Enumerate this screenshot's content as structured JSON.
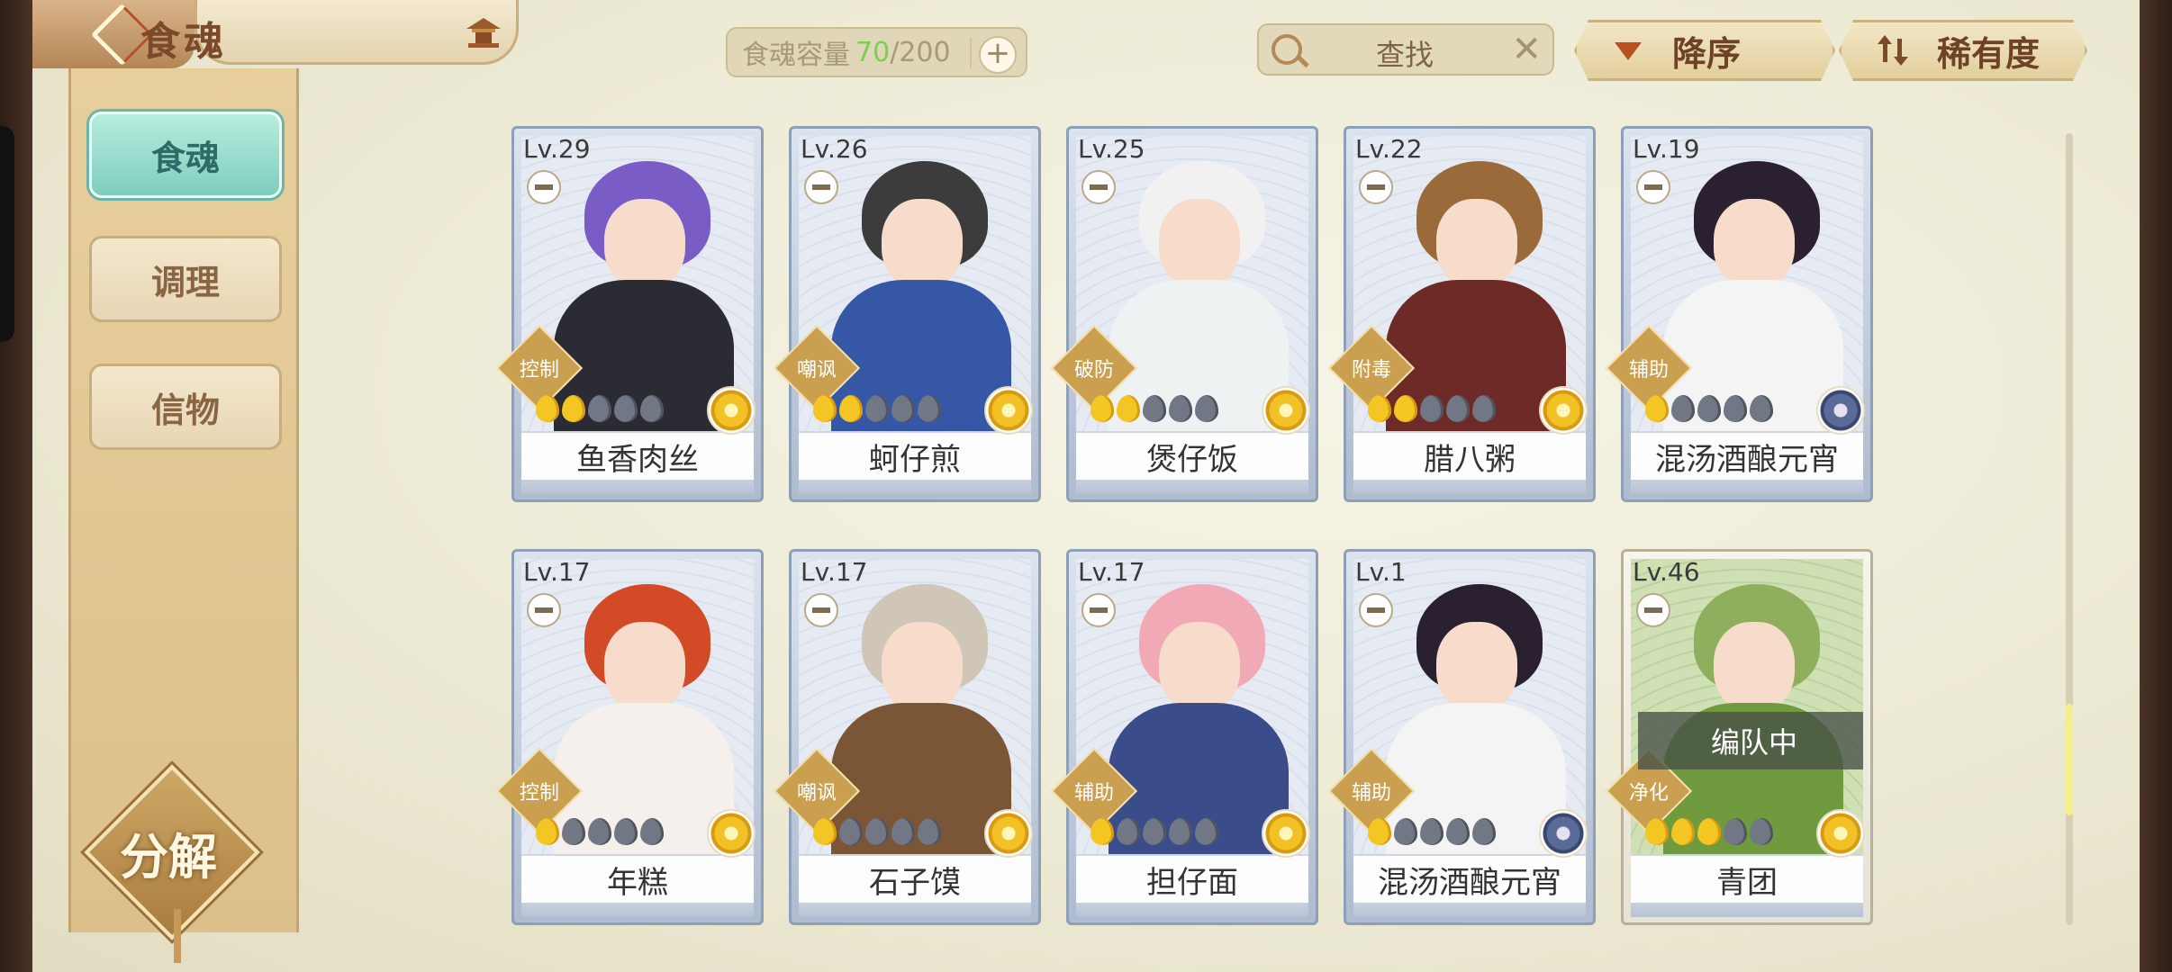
{
  "header": {
    "title": "食魂",
    "capacity_label": "食魂容量",
    "capacity_current": "70",
    "capacity_total": "/200",
    "capacity_plus": "+",
    "search_placeholder": "查找",
    "search_clear": "✕",
    "sort_order_label": "降序",
    "sort_by_label": "稀有度"
  },
  "sidebar": {
    "tabs": [
      {
        "label": "食魂",
        "active": true
      },
      {
        "label": "调理",
        "active": false
      },
      {
        "label": "信物",
        "active": false
      }
    ],
    "decompose_label": "分解"
  },
  "cards": [
    {
      "level": "Lv.29",
      "name": "鱼香肉丝",
      "role": "控制",
      "stars": 2,
      "flower": "gold",
      "hair": "#7a5cc7",
      "outfit": "#2b2b33"
    },
    {
      "level": "Lv.26",
      "name": "蚵仔煎",
      "role": "嘲讽",
      "stars": 2,
      "flower": "gold",
      "hair": "#3c3c3c",
      "outfit": "#3657a6"
    },
    {
      "level": "Lv.25",
      "name": "煲仔饭",
      "role": "破防",
      "stars": 2,
      "flower": "gold",
      "hair": "#f1f1f1",
      "outfit": "#eef2f2"
    },
    {
      "level": "Lv.22",
      "name": "腊八粥",
      "role": "附毒",
      "stars": 2,
      "flower": "gold",
      "hair": "#9a6a3a",
      "outfit": "#6e2a26"
    },
    {
      "level": "Lv.19",
      "name": "混汤酒酿元宵",
      "role": "辅助",
      "stars": 1,
      "flower": "dark",
      "hair": "#2a2030",
      "outfit": "#f4f4f4"
    },
    {
      "level": "Lv.17",
      "name": "年糕",
      "role": "控制",
      "stars": 1,
      "flower": "gold",
      "hair": "#d24a26",
      "outfit": "#f6f0ec"
    },
    {
      "level": "Lv.17",
      "name": "石子馍",
      "role": "嘲讽",
      "stars": 1,
      "flower": "gold",
      "hair": "#cfc6b8",
      "outfit": "#7a5536"
    },
    {
      "level": "Lv.17",
      "name": "担仔面",
      "role": "辅助",
      "stars": 1,
      "flower": "gold",
      "hair": "#f2a9b6",
      "outfit": "#3a4d8a"
    },
    {
      "level": "Lv.1",
      "name": "混汤酒酿元宵",
      "role": "辅助",
      "stars": 1,
      "flower": "dark",
      "hair": "#2a2030",
      "outfit": "#f4f4f4"
    },
    {
      "level": "Lv.46",
      "name": "青团",
      "role": "净化",
      "stars": 3,
      "flower": "gold",
      "hair": "#8fae5e",
      "outfit": "#6f9a3e",
      "team_status": "编队中"
    }
  ],
  "colors": {
    "accent_teal": "#7fcdbd",
    "capacity_green": "#7ccf52",
    "star_on": "#f4c623",
    "star_off": "#717785",
    "gold_trim": "#caa050"
  }
}
